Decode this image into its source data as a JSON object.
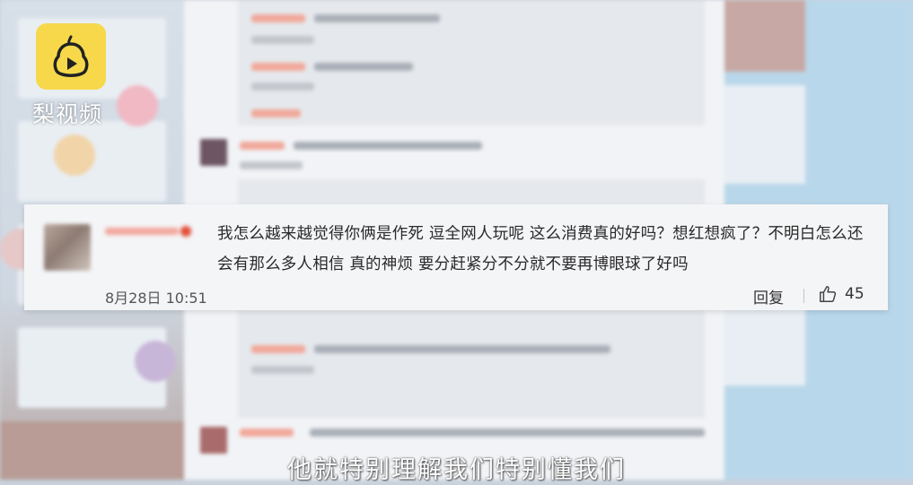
{
  "watermark": {
    "brand_text": "梨视频",
    "logo_icon": "pear-play-icon",
    "logo_color": "#f7d84b"
  },
  "focused_comment": {
    "text": "我怎么越来越觉得你俩是作死 逗全网人玩呢 这么消费真的好吗？想红想疯了？不明白怎么还会有那么多人相信 真的神烦 要分赶紧分不分就不要再博眼球了好吗",
    "timestamp": "8月28日 10:51",
    "reply_label": "回复",
    "like_icon": "thumbs-up-icon",
    "like_count": "45"
  },
  "subtitle": "他就特别理解我们特别懂我们",
  "colors": {
    "card_bg": "#f4f5f7",
    "text": "#2a2a2a",
    "username": "#f2a59b"
  }
}
